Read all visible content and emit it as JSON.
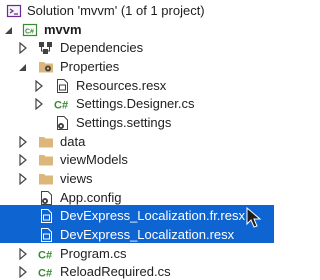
{
  "solution": {
    "label": "Solution 'mvvm' (1 of 1 project)"
  },
  "project": {
    "label": "mvvm"
  },
  "items": {
    "dependencies": "Dependencies",
    "properties": "Properties",
    "resources_resx": "Resources.resx",
    "settings_designer": "Settings.Designer.cs",
    "settings_settings": "Settings.settings",
    "data": "data",
    "viewmodels": "viewModels",
    "views": "views",
    "app_config": "App.config",
    "loc_fr": "DevExpress_Localization.fr.resx",
    "loc": "DevExpress_Localization.resx",
    "program": "Program.cs",
    "reload": "ReloadRequired.cs"
  },
  "colors": {
    "selection": "#0e64d1",
    "folder": "#dcb67a",
    "csharp": "#388a34",
    "project": "#388a34"
  }
}
